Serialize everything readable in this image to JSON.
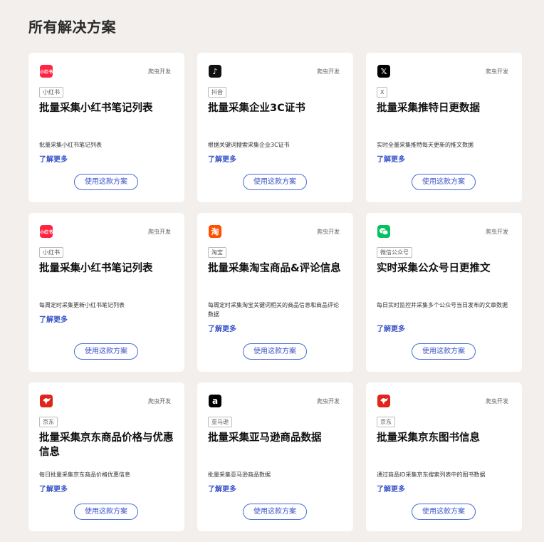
{
  "page": {
    "title": "所有解决方案"
  },
  "cards": [
    {
      "logo_icon": "xiaohongshu-logo-icon",
      "logo_text": "小红书",
      "logo_color": "#ff2442",
      "dev_label": "爬虫开发",
      "tag": "小红书",
      "title": "批量采集小红书笔记列表",
      "description": "批量采集小红书笔记列表",
      "more_label": "了解更多",
      "button_label": "使用这款方案"
    },
    {
      "logo_icon": "douyin-logo-icon",
      "logo_text": "♪",
      "logo_color": "#111111",
      "dev_label": "爬虫开发",
      "tag": "抖音",
      "title": "批量采集企业3C证书",
      "description": "根据关键词搜索采集企业3C证书",
      "more_label": "了解更多",
      "button_label": "使用这款方案"
    },
    {
      "logo_icon": "x-twitter-logo-icon",
      "logo_text": "𝕏",
      "logo_color": "#000000",
      "dev_label": "爬虫开发",
      "tag": "X",
      "title": "批量采集推特日更数据",
      "description": "实时全量采集推特每天更新的推文数据",
      "more_label": "了解更多",
      "button_label": "使用这款方案"
    },
    {
      "logo_icon": "xiaohongshu-logo-icon",
      "logo_text": "小红书",
      "logo_color": "#ff2442",
      "dev_label": "爬虫开发",
      "tag": "小红书",
      "title": "批量采集小红书笔记列表",
      "description": "每周定时采集更新小红书笔记列表",
      "more_label": "了解更多",
      "button_label": "使用这款方案"
    },
    {
      "logo_icon": "taobao-logo-icon",
      "logo_text": "淘",
      "logo_color": "#ff5000",
      "dev_label": "爬虫开发",
      "tag": "淘宝",
      "title": "批量采集淘宝商品&评论信息",
      "description": "每周定时采集淘宝关键词相关的商品信息和商品评论数据",
      "more_label": "了解更多",
      "button_label": "使用这款方案"
    },
    {
      "logo_icon": "wechat-logo-icon",
      "logo_text": "",
      "logo_color": "#07c160",
      "dev_label": "爬虫开发",
      "tag": "微信公众号",
      "title": "实时采集公众号日更推文",
      "description": "每日实时监控并采集多个公众号当日发布的文章数据",
      "more_label": "了解更多",
      "button_label": "使用这款方案"
    },
    {
      "logo_icon": "jd-logo-icon",
      "logo_text": "",
      "logo_color": "#e1251b",
      "dev_label": "爬虫开发",
      "tag": "京东",
      "title": "批量采集京东商品价格与优惠信息",
      "description": "每日批量采集京东商品价格优惠信息",
      "more_label": "了解更多",
      "button_label": "使用这款方案"
    },
    {
      "logo_icon": "amazon-logo-icon",
      "logo_text": "a",
      "logo_color": "#000000",
      "dev_label": "爬虫开发",
      "tag": "亚马逊",
      "title": "批量采集亚马逊商品数据",
      "description": "批量采集亚马逊商品数据",
      "more_label": "了解更多",
      "button_label": "使用这款方案"
    },
    {
      "logo_icon": "jd-logo-icon",
      "logo_text": "",
      "logo_color": "#e1251b",
      "dev_label": "爬虫开发",
      "tag": "京东",
      "title": "批量采集京东图书信息",
      "description": "通过商品ID采集京东搜索列表中的图书数据",
      "more_label": "了解更多",
      "button_label": "使用这款方案"
    }
  ]
}
